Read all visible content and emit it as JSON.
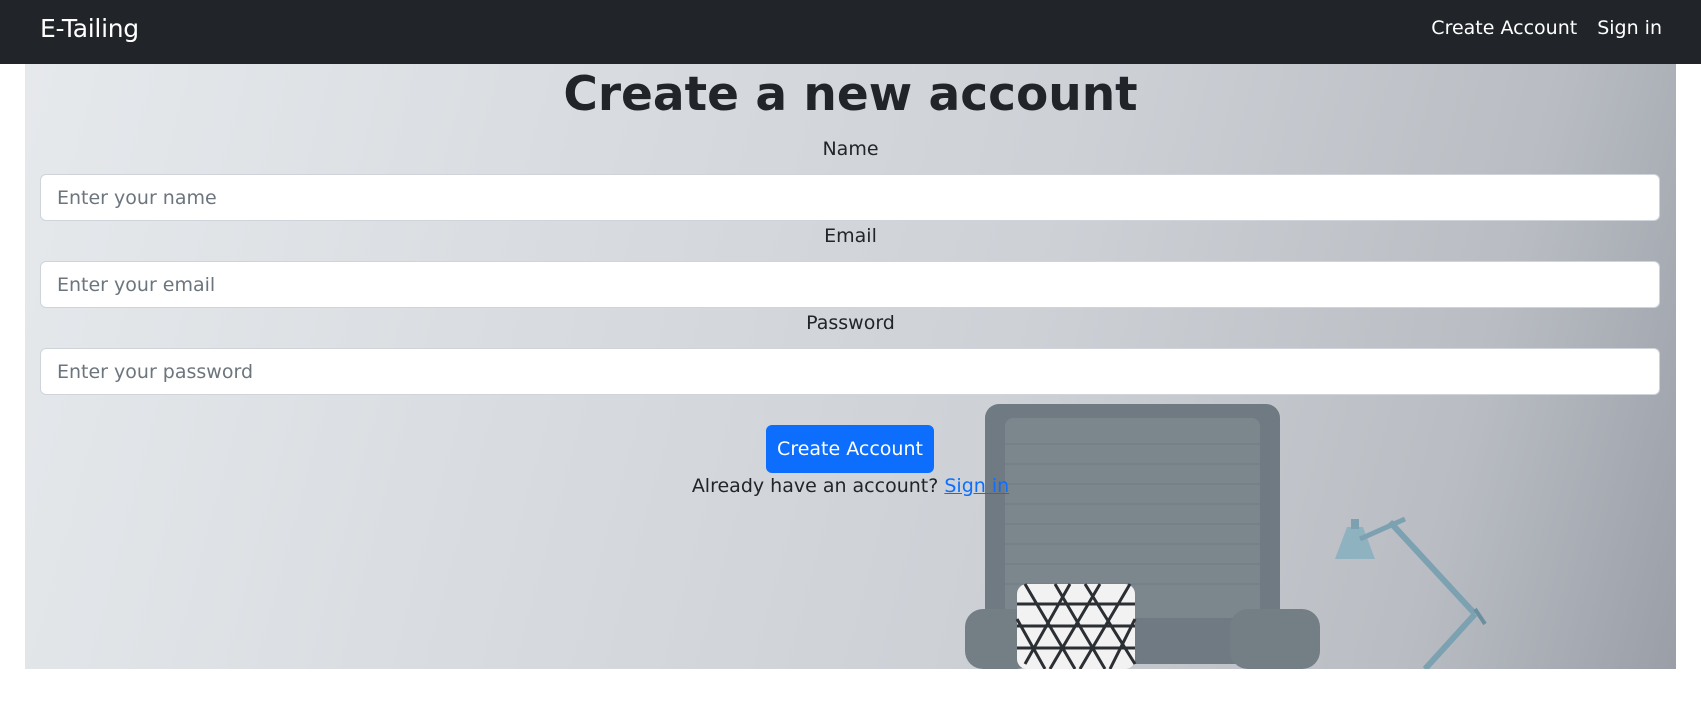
{
  "navbar": {
    "brand": "E-Tailing",
    "links": [
      {
        "label": "Create Account"
      },
      {
        "label": "Sign in"
      }
    ]
  },
  "form": {
    "title": "Create a new account",
    "name": {
      "label": "Name",
      "placeholder": "Enter your name",
      "value": ""
    },
    "email": {
      "label": "Email",
      "placeholder": "Enter your email",
      "value": ""
    },
    "password": {
      "label": "Password",
      "placeholder": "Enter your password",
      "value": ""
    },
    "submit_label": "Create Account",
    "signin_prompt": "Already have an account?",
    "signin_link": "Sign in"
  },
  "colors": {
    "navbar_bg": "#212529",
    "primary": "#0d6efd"
  },
  "icons": [
    "armchair-image",
    "cushion-image",
    "desk-lamp-image"
  ]
}
